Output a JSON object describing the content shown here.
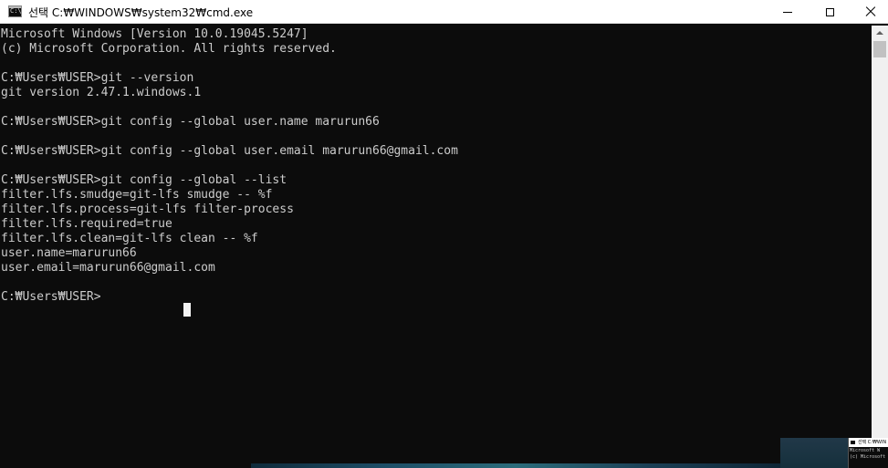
{
  "window": {
    "title": "선택 C:₩WINDOWS₩system32₩cmd.exe",
    "icon": "cmd-icon",
    "icon_glyph": "C:\\"
  },
  "console": {
    "text": "Microsoft Windows [Version 10.0.19045.5247]\n(c) Microsoft Corporation. All rights reserved.\n\nC:₩Users₩USER>git --version\ngit version 2.47.1.windows.1\n\nC:₩Users₩USER>git config --global user.name marurun66\n\nC:₩Users₩USER>git config --global user.email marurun66@gmail.com\n\nC:₩Users₩USER>git config --global --list\nfilter.lfs.smudge=git-lfs smudge -- %f\nfilter.lfs.process=git-lfs filter-process\nfilter.lfs.required=true\nfilter.lfs.clean=git-lfs clean -- %f\nuser.name=marurun66\nuser.email=marurun66@gmail.com\n\nC:₩Users₩USER>"
  },
  "taskbar_preview": {
    "title": "선택 C:₩WIN",
    "text": "Microsoft W\n(c) Microsoft"
  },
  "colors": {
    "console_bg": "#0c0c0c",
    "console_fg": "#cccccc",
    "titlebar_bg": "#ffffff"
  }
}
